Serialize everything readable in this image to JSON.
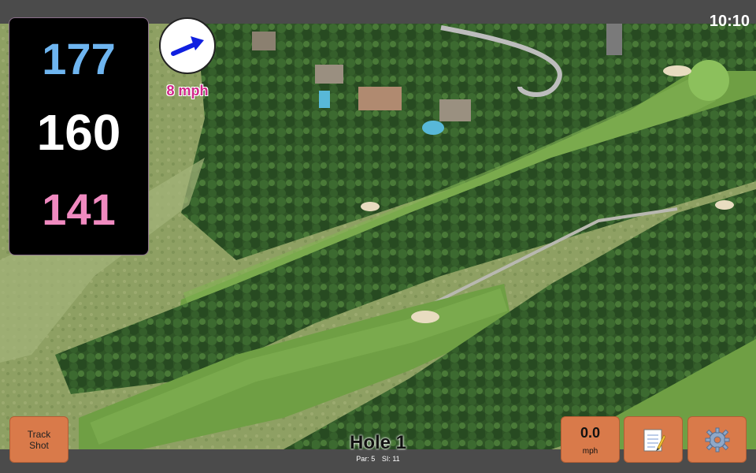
{
  "status_bar": {
    "time": "10:10"
  },
  "distances": {
    "back": "177",
    "middle": "160",
    "front": "141"
  },
  "wind": {
    "speed_label": "8 mph",
    "direction_icon": "arrow-icon"
  },
  "buttons": {
    "track_shot": [
      "Track",
      "Shot"
    ],
    "wind_speed_value": "0.0",
    "wind_speed_unit": "mph",
    "notes_icon": "notepad-icon",
    "settings_icon": "gear-icon"
  },
  "hole": {
    "title": "Hole 1",
    "par": "Par: 5",
    "si": "SI: 11"
  },
  "colors": {
    "back": "#6eb5f0",
    "middle": "#ffffff",
    "front": "#f08ac0",
    "wind_label": "#d0288a",
    "button": "#d97a4a"
  }
}
